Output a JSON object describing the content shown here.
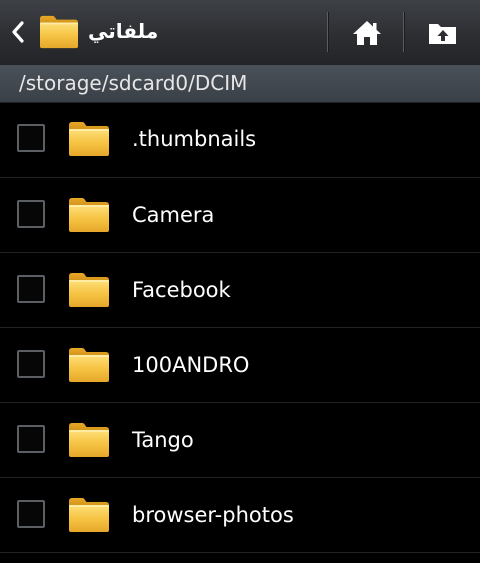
{
  "header": {
    "title": "ملفاتي",
    "back_icon": "chevron-left-icon",
    "app_icon": "folder-icon",
    "home_icon": "home-icon",
    "up_icon": "folder-up-icon"
  },
  "path": {
    "current": "/storage/sdcard0/DCIM"
  },
  "files": [
    {
      "name": ".thumbnails",
      "type": "folder",
      "checked": false
    },
    {
      "name": "Camera",
      "type": "folder",
      "checked": false
    },
    {
      "name": "Facebook",
      "type": "folder",
      "checked": false
    },
    {
      "name": "100ANDRO",
      "type": "folder",
      "checked": false
    },
    {
      "name": "Tango",
      "type": "folder",
      "checked": false
    },
    {
      "name": "browser-photos",
      "type": "folder",
      "checked": false
    }
  ],
  "colors": {
    "folder_body": "#f6c444",
    "folder_tab": "#e8a927",
    "background": "#000000",
    "path_bar": "#434a52"
  }
}
